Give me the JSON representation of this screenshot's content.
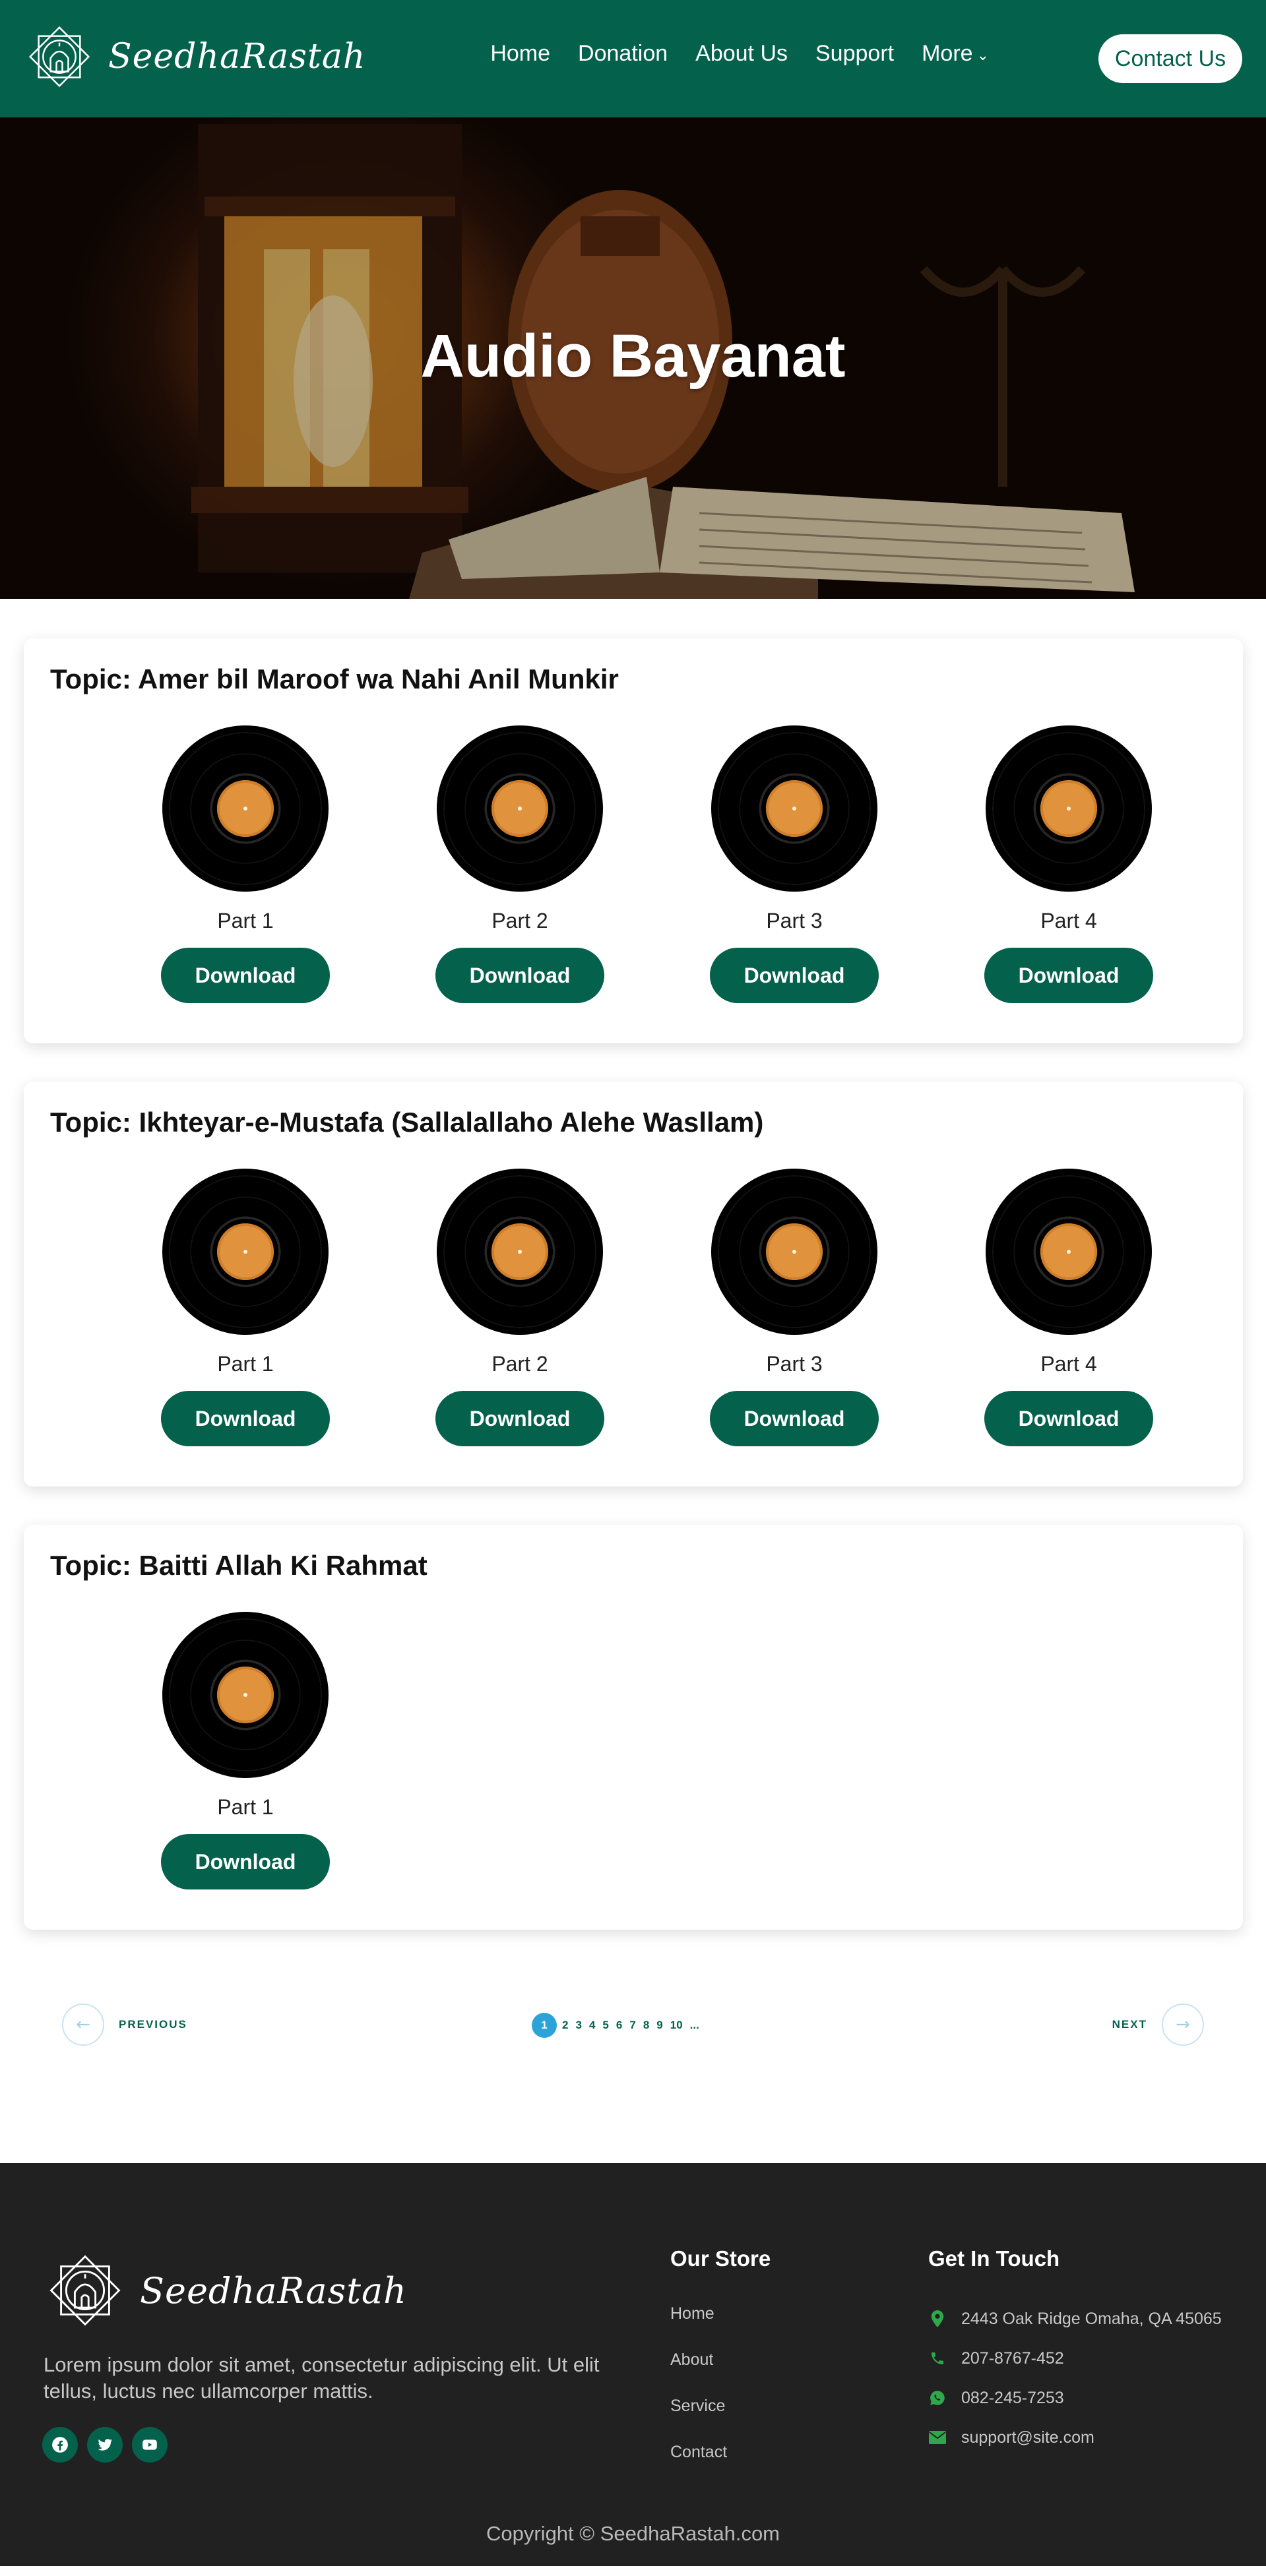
{
  "brand": {
    "name": "SeedhaRastah"
  },
  "nav": {
    "items": [
      {
        "label": "Home"
      },
      {
        "label": "Donation"
      },
      {
        "label": "About Us"
      },
      {
        "label": "Support"
      },
      {
        "label": "More"
      }
    ],
    "contact_label": "Contact Us"
  },
  "hero": {
    "title": "Audio Bayanat"
  },
  "topics": [
    {
      "prefix": "Topic:",
      "name": "Amer bil Maroof wa Nahi Anil Munkir",
      "parts": [
        {
          "label": "Part 1",
          "button": "Download"
        },
        {
          "label": "Part 2",
          "button": "Download"
        },
        {
          "label": "Part 3",
          "button": "Download"
        },
        {
          "label": "Part 4",
          "button": "Download"
        }
      ]
    },
    {
      "prefix": "Topic:",
      "name": "Ikhteyar-e-Mustafa (Sallalallaho Alehe Wasllam)",
      "parts": [
        {
          "label": "Part 1",
          "button": "Download"
        },
        {
          "label": "Part 2",
          "button": "Download"
        },
        {
          "label": "Part 3",
          "button": "Download"
        },
        {
          "label": "Part 4",
          "button": "Download"
        }
      ]
    },
    {
      "prefix": "Topic:",
      "name": "Baitti Allah Ki Rahmat",
      "parts": [
        {
          "label": "Part 1",
          "button": "Download"
        }
      ]
    }
  ],
  "pagination": {
    "prev_label": "PREVIOUS",
    "next_label": "NEXT",
    "current": "1",
    "pages": [
      "1",
      "2",
      "3",
      "4",
      "5",
      "6",
      "7",
      "8",
      "9",
      "10",
      "..."
    ]
  },
  "footer": {
    "description": "Lorem ipsum dolor sit amet, consectetur adipiscing elit. Ut elit tellus, luctus nec ullamcorper mattis.",
    "store_title": "Our Store",
    "store_links": [
      "Home",
      "About",
      "Service",
      "Contact"
    ],
    "touch_title": "Get In Touch",
    "address": "2443 Oak Ridge Omaha, QA 45065",
    "phone": "207-8767-452",
    "whatsapp": "082-245-7253",
    "email": "support@site.com",
    "socials": [
      "facebook-icon",
      "twitter-icon",
      "youtube-icon"
    ],
    "copyright": "Copyright © SeedhaRastah.com"
  },
  "colors": {
    "primary": "#04614c",
    "footer_bg": "#212121",
    "active_page": "#2ba3d9",
    "vinyl_label": "#e0923d"
  }
}
